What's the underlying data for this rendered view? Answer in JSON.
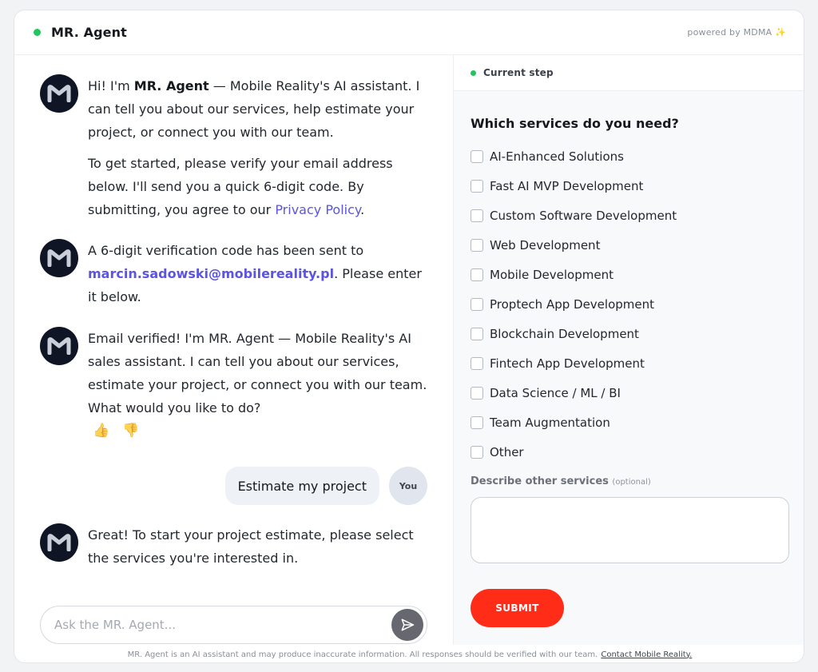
{
  "header": {
    "title": "MR. Agent",
    "powered_by": "powered by MDMA",
    "sparkle": "✨"
  },
  "chat": {
    "messages": [
      {
        "p1_intro": "Hi! I'm ",
        "p1_name": "MR. Agent",
        "p1_rest": " — Mobile Reality's AI assistant. I can tell you about our services, help estimate your project, or connect you with our team.",
        "p2_text": "To get started, please verify your email address below. I'll send you a quick 6-digit code. By submitting, you agree to our ",
        "p2_link": "Privacy Policy",
        "p2_end": "."
      },
      {
        "text_before": "A 6-digit verification code has been sent to ",
        "email": "marcin.sadowski@mobilereality.pl",
        "text_after": ". Please enter it below."
      },
      {
        "text": "Email verified! I'm MR. Agent — Mobile Reality's AI sales assistant. I can tell you about our services, estimate your project, or connect you with our team. What would you like to do?"
      },
      {
        "text": "Great! To start your project estimate, please select the services you're interested in."
      }
    ],
    "reactions": {
      "like": "👍",
      "dislike": "👎"
    },
    "user_message": {
      "text": "Estimate my project",
      "avatar_label": "You"
    },
    "input": {
      "placeholder": "Ask the MR. Agent...",
      "value": ""
    },
    "send_icon": "send-icon"
  },
  "side": {
    "step_label": "Current step",
    "form_title": "Which services do you need?",
    "options": [
      "AI-Enhanced Solutions",
      "Fast AI MVP Development",
      "Custom Software Development",
      "Web Development",
      "Mobile Development",
      "Proptech App Development",
      "Blockchain Development",
      "Fintech App Development",
      "Data Science / ML / BI",
      "Team Augmentation",
      "Other"
    ],
    "other_label": "Describe other services",
    "other_optional": "(optional)",
    "other_value": "",
    "submit_label": "SUBMIT"
  },
  "footer": {
    "disclaimer": "MR. Agent is an AI assistant and may produce inaccurate information. All responses should be verified with our team.",
    "contact_link": "Contact Mobile Reality."
  },
  "colors": {
    "online": "#22c55e",
    "link": "#5b55e0",
    "submit": "#ff2d18",
    "avatar_bg": "#0f1524"
  }
}
